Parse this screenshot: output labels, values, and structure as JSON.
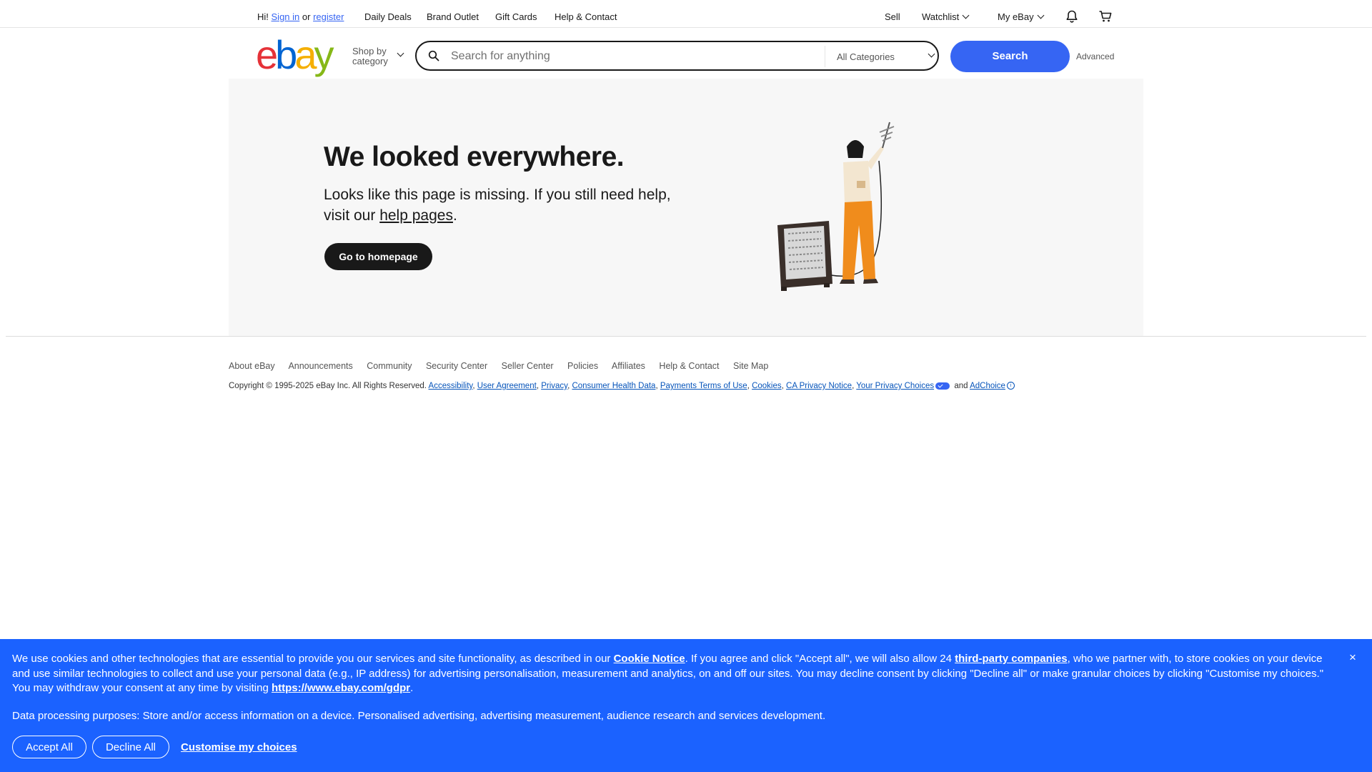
{
  "topbar": {
    "greeting": "Hi!",
    "sign_in": "Sign in",
    "or": "or",
    "register": "register",
    "links": [
      "Daily Deals",
      "Brand Outlet",
      "Gift Cards",
      "Help & Contact"
    ],
    "sell": "Sell",
    "watchlist": "Watchlist",
    "my_ebay": "My eBay"
  },
  "header": {
    "logo_letters": [
      "e",
      "b",
      "a",
      "y"
    ],
    "shop_by_line1": "Shop by",
    "shop_by_line2": "category",
    "search_placeholder": "Search for anything",
    "category": "All Categories",
    "search_button": "Search",
    "advanced": "Advanced"
  },
  "hero": {
    "title": "We looked everywhere.",
    "message_part1": "Looks like this page is missing. If you still need help, visit our ",
    "help_link": "help pages",
    "message_end": ".",
    "button": "Go to homepage"
  },
  "footer": {
    "links": [
      "About eBay",
      "Announcements",
      "Community",
      "Security Center",
      "Seller Center",
      "Policies",
      "Affiliates",
      "Help & Contact",
      "Site Map"
    ],
    "copyright": "Copyright © 1995-2025 eBay Inc. All Rights Reserved.",
    "legal": {
      "accessibility": "Accessibility",
      "user_agreement": "User Agreement",
      "privacy": "Privacy",
      "consumer_health": "Consumer Health Data",
      "payments_terms": "Payments Terms of Use",
      "cookies": "Cookies",
      "ca_privacy": "CA Privacy Notice",
      "privacy_choices": "Your Privacy Choices",
      "and": "and",
      "adchoice": "AdChoice"
    }
  },
  "cookie": {
    "text_1": "We use cookies and other technologies that are essential to provide you our services and site functionality, as described in our ",
    "cookie_notice": "Cookie Notice",
    "text_2": ". If you agree and click \"Accept all\", we will also allow 24 ",
    "third_party": "third-party companies",
    "text_3": ", who we partner with, to store cookies on your device and use similar technologies to collect and use your personal data (e.g., IP address) for advertising personalisation, measurement and analytics, on and off our sites. You may decline consent by clicking \"Decline all\" or make granular choices by clicking \"Customise my choices.\" You may withdraw your consent at any time by visiting ",
    "gdpr_link": "https://www.ebay.com/gdpr",
    "text_4": ".",
    "purposes": "Data processing purposes: Store and/or access information on a device. Personalised advertising, advertising measurement, audience research and services development.",
    "accept": "Accept All",
    "decline": "Decline All",
    "customise": "Customise my choices",
    "close": "×"
  },
  "colors": {
    "ebay_e": "#e53238",
    "ebay_b": "#0064d2",
    "ebay_a": "#f5af02",
    "ebay_y": "#86b817",
    "primary_blue": "#3665f3",
    "cookie_banner": "#1b62ff",
    "hero_bg": "#f7f7f7"
  },
  "icons": [
    "search-icon",
    "bell-icon",
    "cart-icon",
    "chevron-down-icon",
    "close-icon",
    "privacy-choices-icon",
    "adchoice-icon"
  ]
}
